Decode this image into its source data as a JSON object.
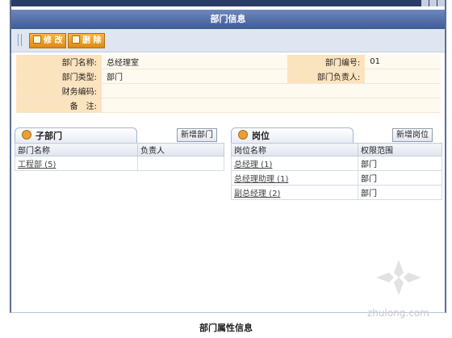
{
  "header": {
    "title": "部门信息"
  },
  "toolbar": {
    "edit_label": "修 改",
    "delete_label": "删 除"
  },
  "info": {
    "name_label": "部门名称:",
    "name_value": "总经理室",
    "code_label": "部门编号:",
    "code_value": "01",
    "type_label": "部门类型:",
    "type_value": "部门",
    "head_label": "部门负责人:",
    "head_value": "",
    "finance_label": "财务编码:",
    "finance_value": "",
    "note_label": "备　注:",
    "note_value": ""
  },
  "sub_departments": {
    "tab_label": "子部门",
    "add_label": "新增部门",
    "columns": [
      "部门名称",
      "负责人"
    ],
    "rows": [
      {
        "name": "工程部 (5)",
        "head": ""
      }
    ]
  },
  "positions": {
    "tab_label": "岗位",
    "add_label": "新增岗位",
    "columns": [
      "岗位名称",
      "权限范围"
    ],
    "rows": [
      {
        "name": "总经理 (1)",
        "scope": "部门"
      },
      {
        "name": "总经理助理 (1)",
        "scope": "部门"
      },
      {
        "name": "副总经理 (2)",
        "scope": "部门"
      }
    ]
  },
  "caption": "部门属性信息",
  "watermark": "zhulong.com",
  "colors": {
    "header": "#3f5b95",
    "button": "#de8a16",
    "label_bg": "#fbe3bd"
  }
}
